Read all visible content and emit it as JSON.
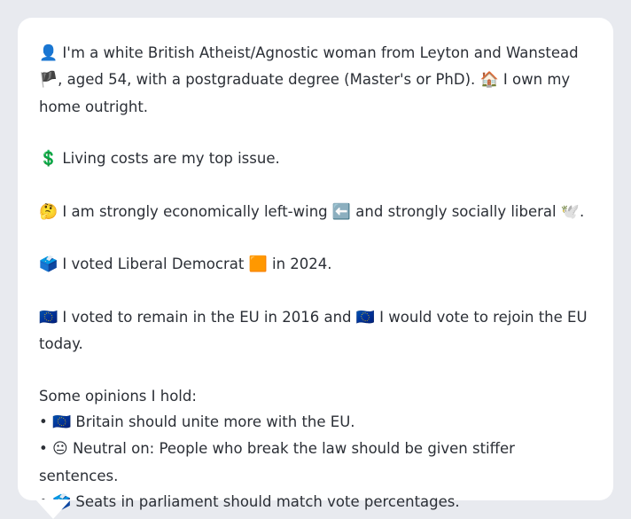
{
  "profile": {
    "intro": {
      "icon": "👤",
      "text_1": " I'm a white British Atheist/Agnostic woman from Leyton and Wanstead ",
      "flag": "🏴",
      "text_2": ", aged 54, with a postgraduate degree (Master's or PhD). ",
      "home_icon": "🏠",
      "text_3": " I own my home outright."
    },
    "top_issue": {
      "icon": "💲",
      "text": " Living costs are my top issue."
    },
    "political_position": {
      "icon": "🤔",
      "text_1": " I am strongly economically left-wing ",
      "left_icon": "⬅️",
      "text_2": " and strongly socially liberal ",
      "dove_icon": "🕊️",
      "text_3": "."
    },
    "vote_2024": {
      "icon": "🗳️",
      "text_1": " I voted Liberal Democrat ",
      "party_icon": "🟧",
      "text_2": " in 2024."
    },
    "eu": {
      "icon_1": "🇪🇺",
      "text_1": " I voted to remain in the EU in 2016 and ",
      "icon_2": "🇪🇺",
      "text_2": " I would vote to rejoin the EU today."
    },
    "opinions": {
      "heading": "Some opinions I hold:",
      "bullet": "•",
      "items": [
        {
          "icon": "🇪🇺",
          "text": " Britain should unite more with the EU."
        },
        {
          "icon": "😐",
          "text": " Neutral on: People who break the law should be given stiffer sentences."
        },
        {
          "icon": "🗳️",
          "text": " Seats in parliament should match vote percentages."
        }
      ]
    }
  }
}
